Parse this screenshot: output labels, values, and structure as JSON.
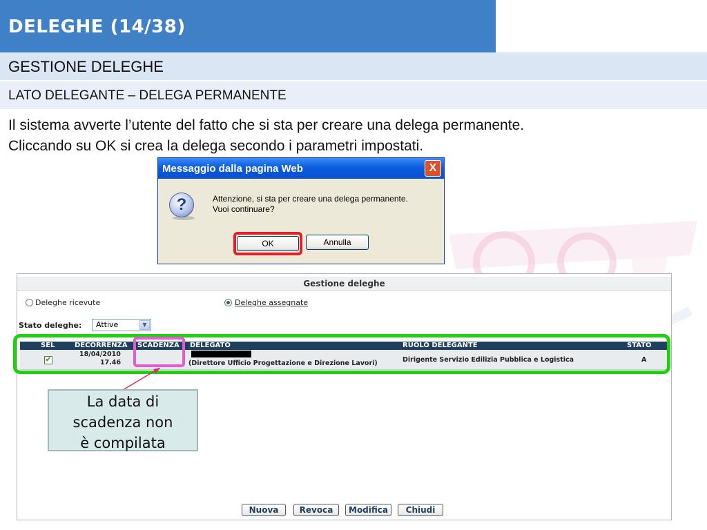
{
  "slide": {
    "title": "DELEGHE (14/38)",
    "section": "GESTIONE DELEGHE",
    "subsection": "LATO DELEGANTE – DELEGA PERMANENTE",
    "intro_line1": "Il sistema avverte l’utente del fatto che si sta per creare una delega permanente.",
    "intro_line2": "Cliccando su OK si crea la delega secondo i parametri impostati."
  },
  "dialog": {
    "title": "Messaggio dalla pagina Web",
    "close": "X",
    "message_line1": "Attenzione, si sta per creare una delega permanente.",
    "message_line2": "Vuoi continuare?",
    "ok_label": "OK",
    "cancel_label": "Annulla"
  },
  "panel": {
    "title": "Gestione deleghe",
    "radio_received": "Deleghe ricevute",
    "radio_assigned": "Deleghe assegnate",
    "status_label": "Stato deleghe:",
    "status_value": "Attive",
    "columns": [
      "SEL",
      "DECORRENZA",
      "SCADENZA",
      "DELEGATO",
      "RUOLO DELEGANTE",
      "STATO"
    ],
    "row": {
      "selected": true,
      "decorrenza_date": "18/04/2010",
      "decorrenza_time": "17.46",
      "scadenza": "",
      "delegato_role": "(Direttore Ufficio Progettazione e Direzione Lavori)",
      "ruolo_delegante": "Dirigente Servizio Edilizia Pubblica e Logistica",
      "stato": "A"
    },
    "buttons": {
      "nuova": "Nuova",
      "revoca": "Revoca",
      "modifica": "Modifica",
      "chiudi": "Chiudi"
    }
  },
  "callout": {
    "line1": "La data di",
    "line2": "scadenza non",
    "line3": "è compilata"
  },
  "colors": {
    "title_bg": "#3f80c6",
    "ok_highlight": "#e41e26",
    "row_highlight": "#22d012",
    "scadenza_highlight": "#e65ad2",
    "callout_bg": "#d9eaea"
  }
}
